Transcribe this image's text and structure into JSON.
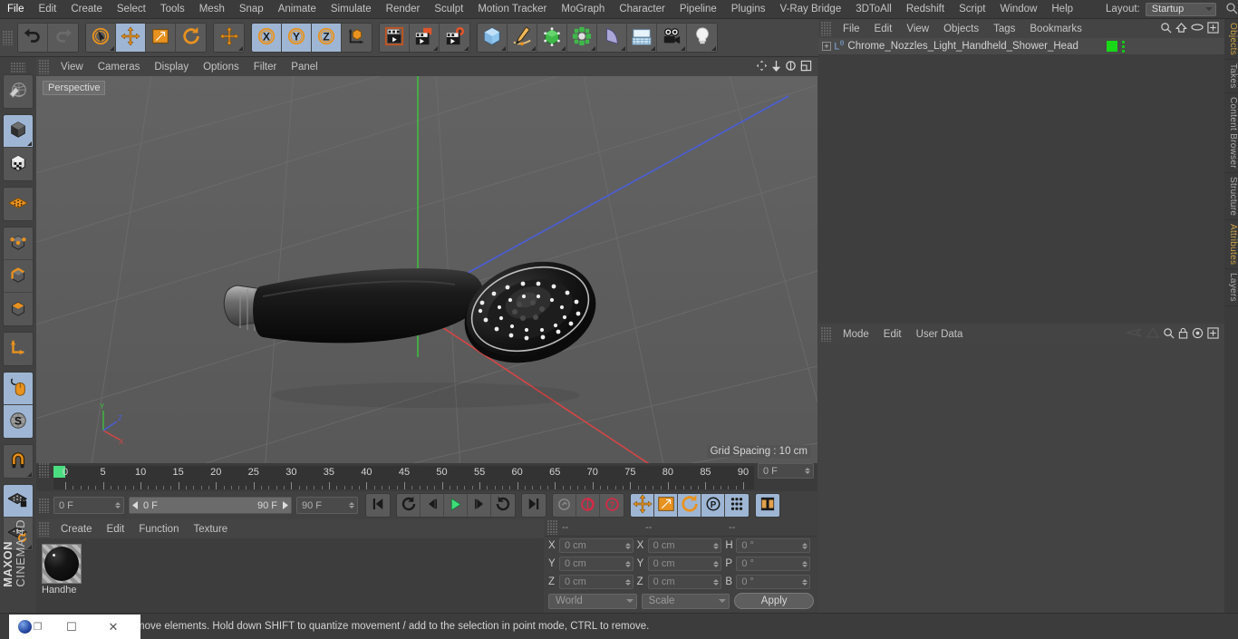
{
  "menubar": {
    "items": [
      "File",
      "Edit",
      "Create",
      "Select",
      "Tools",
      "Mesh",
      "Snap",
      "Animate",
      "Simulate",
      "Render",
      "Sculpt",
      "Motion Tracker",
      "MoGraph",
      "Character",
      "Pipeline",
      "Plugins",
      "V-Ray Bridge",
      "3DToAll",
      "Redshift",
      "Script",
      "Window",
      "Help"
    ],
    "layout_label": "Layout:",
    "layout_value": "Startup",
    "search_icon": "search-icon"
  },
  "toolbar": {
    "groups": [
      {
        "name": "undo-redo",
        "buttons": [
          {
            "name": "undo-button",
            "icon": "undo-icon",
            "active": false
          },
          {
            "name": "redo-button",
            "icon": "redo-icon",
            "active": false
          }
        ]
      },
      {
        "name": "transform-tools",
        "buttons": [
          {
            "name": "select-tool",
            "icon": "live-selection-icon",
            "active": false
          },
          {
            "name": "move-tool",
            "icon": "move-icon",
            "active": true
          },
          {
            "name": "scale-tool",
            "icon": "scale-icon",
            "active": false
          },
          {
            "name": "rotate-tool",
            "icon": "rotate-icon",
            "active": false
          }
        ]
      },
      {
        "name": "move-group",
        "buttons": [
          {
            "name": "move-tool-2",
            "icon": "move-icon",
            "active": false
          }
        ]
      },
      {
        "name": "axis-locks",
        "buttons": [
          {
            "name": "lock-x-button",
            "icon": "x-axis-icon",
            "active": true
          },
          {
            "name": "lock-y-button",
            "icon": "y-axis-icon",
            "active": true
          },
          {
            "name": "lock-z-button",
            "icon": "z-axis-icon",
            "active": true
          },
          {
            "name": "world-object-coord-button",
            "icon": "world-axis-icon",
            "active": false
          }
        ]
      },
      {
        "name": "render-tools",
        "buttons": [
          {
            "name": "render-view-button",
            "icon": "render-view-icon",
            "active": false
          },
          {
            "name": "render-region-button",
            "icon": "render-region-icon",
            "active": false
          },
          {
            "name": "render-settings-button",
            "icon": "render-settings-icon",
            "active": false
          }
        ]
      },
      {
        "name": "create-objects",
        "buttons": [
          {
            "name": "add-cube-button",
            "icon": "cube-icon",
            "active": false
          },
          {
            "name": "add-spline-button",
            "icon": "pen-spline-icon",
            "active": false
          },
          {
            "name": "add-generator-button",
            "icon": "green-cube-icon",
            "active": false
          },
          {
            "name": "add-deformer-button",
            "icon": "mograph-icon",
            "active": false
          },
          {
            "name": "add-bend-button",
            "icon": "bend-deformer-icon",
            "active": false
          },
          {
            "name": "add-environment-button",
            "icon": "floor-environment-icon",
            "active": false
          },
          {
            "name": "add-camera-button",
            "icon": "camera-icon",
            "active": false
          },
          {
            "name": "add-light-button",
            "icon": "light-bulb-icon",
            "active": false
          }
        ]
      }
    ]
  },
  "lefttools": {
    "groups": [
      {
        "buttons": [
          {
            "name": "make-editable-button",
            "icon": "make-editable-icon",
            "active": false
          }
        ]
      },
      {
        "buttons": [
          {
            "name": "model-mode-button",
            "icon": "model-mode-icon",
            "active": true
          },
          {
            "name": "texture-mode-button",
            "icon": "texture-mode-icon",
            "active": false
          }
        ]
      },
      {
        "buttons": [
          {
            "name": "points-deform-button",
            "icon": "mesh-grid-icon",
            "active": false
          }
        ]
      },
      {
        "buttons": [
          {
            "name": "points-mode-button",
            "icon": "points-mode-icon",
            "active": false
          },
          {
            "name": "edges-mode-button",
            "icon": "edges-mode-icon",
            "active": false
          },
          {
            "name": "polygons-mode-button",
            "icon": "polygons-mode-icon",
            "active": false
          }
        ]
      },
      {
        "buttons": [
          {
            "name": "object-axis-button",
            "icon": "axis-icon",
            "active": false
          }
        ]
      },
      {
        "buttons": [
          {
            "name": "viewport-solo-button",
            "icon": "mouse-icon",
            "active": true
          },
          {
            "name": "enable-snap-button",
            "icon": "snap-s-icon",
            "active": true
          }
        ]
      },
      {
        "buttons": [
          {
            "name": "magnet-button",
            "icon": "magnet-icon",
            "active": false
          }
        ]
      },
      {
        "buttons": [
          {
            "name": "workplane-lock-button",
            "icon": "workplane-lock-icon",
            "active": true
          },
          {
            "name": "workplane-rotate-button",
            "icon": "workplane-rotate-icon",
            "active": false
          }
        ]
      }
    ],
    "brand_top": "MAXON",
    "brand_bottom": "CINEMA 4D"
  },
  "viewport": {
    "menu": [
      "View",
      "Cameras",
      "Display",
      "Options",
      "Filter",
      "Panel"
    ],
    "icons": [
      "pan-icon",
      "zoom-icon",
      "rotate-view-icon",
      "maximize-view-icon"
    ],
    "perspective_label": "Perspective",
    "grid_spacing": "Grid Spacing : 10 cm",
    "axis_labels": {
      "x": "X",
      "y": "Y",
      "z": "Z"
    }
  },
  "timeline": {
    "ticks": [
      0,
      5,
      10,
      15,
      20,
      25,
      30,
      35,
      40,
      45,
      50,
      55,
      60,
      65,
      70,
      75,
      80,
      85,
      90
    ],
    "current_frame_field": "0 F",
    "playhead_frame": 0
  },
  "transport": {
    "current_frame": "0 F",
    "range_start": "0 F",
    "range_end": "90 F",
    "end_frame": "90 F",
    "buttons": [
      {
        "name": "go-to-start-button",
        "icon": "skip-start-icon",
        "active": false
      },
      {
        "name": "play-backwards-button",
        "icon": "play-back-icon",
        "active": false
      },
      {
        "name": "previous-frame-button",
        "icon": "step-back-icon",
        "active": false
      },
      {
        "name": "play-button",
        "icon": "play-icon",
        "active": false
      },
      {
        "name": "next-frame-button",
        "icon": "step-forward-icon",
        "active": false
      },
      {
        "name": "play-forward-loop-button",
        "icon": "loop-icon",
        "active": false
      },
      {
        "name": "go-to-end-button",
        "icon": "skip-end-icon",
        "active": false
      },
      {
        "name": "record-active-objects-button",
        "icon": "key-icon",
        "active": false
      },
      {
        "name": "autokeying-button",
        "icon": "autokey-icon",
        "active": false
      },
      {
        "name": "keyframe-selection-button",
        "icon": "question-icon",
        "active": false
      },
      {
        "name": "record-position-button",
        "icon": "move-icon",
        "active": true
      },
      {
        "name": "record-scale-button",
        "icon": "scale-icon",
        "active": true
      },
      {
        "name": "record-rotation-button",
        "icon": "rotate-icon",
        "active": true
      },
      {
        "name": "record-param-button",
        "icon": "p-param-icon",
        "active": true
      },
      {
        "name": "record-pla-button",
        "icon": "pla-dots-icon",
        "active": true
      },
      {
        "name": "timeline-toggle-button",
        "icon": "timeline-icon",
        "active": true
      }
    ]
  },
  "material_manager": {
    "menu": [
      "Create",
      "Edit",
      "Function",
      "Texture"
    ],
    "materials": [
      {
        "name": "Handhe",
        "icon": "material-sphere-icon"
      }
    ]
  },
  "coordinates": {
    "headers": [
      "--",
      "--",
      "--"
    ],
    "rows": [
      {
        "label1": "X",
        "value1": "0 cm",
        "label2": "X",
        "value2": "0 cm",
        "label3": "H",
        "value3": "0 °"
      },
      {
        "label1": "Y",
        "value1": "0 cm",
        "label2": "Y",
        "value2": "0 cm",
        "label3": "P",
        "value3": "0 °"
      },
      {
        "label1": "Z",
        "value1": "0 cm",
        "label2": "Z",
        "value2": "0 cm",
        "label3": "B",
        "value3": "0 °"
      }
    ],
    "system": "World",
    "mode": "Scale",
    "apply_label": "Apply"
  },
  "object_manager": {
    "menu": [
      "File",
      "Edit",
      "View",
      "Objects",
      "Tags",
      "Bookmarks"
    ],
    "icons": [
      "search-icon",
      "home-icon",
      "ellipse-icon",
      "plus-box-icon"
    ],
    "objects": [
      {
        "name": "Chrome_Nozzles_Light_Handheld_Shower_Head",
        "icon": "null-object-icon",
        "expandable": true
      }
    ]
  },
  "attribute_manager": {
    "menu": [
      "Mode",
      "Edit",
      "User Data"
    ],
    "icons": [
      "navigate-back-icon",
      "navigate-up-icon",
      "search-icon",
      "lock-icon",
      "target-icon",
      "plus-box-icon"
    ]
  },
  "right_tabs": [
    {
      "label": "Objects",
      "accent": true
    },
    {
      "label": "Takes",
      "accent": false
    },
    {
      "label": "Content Browser",
      "accent": false
    },
    {
      "label": "Structure",
      "accent": false
    },
    {
      "label": "Attributes",
      "accent": true
    },
    {
      "label": "Layers",
      "accent": false
    }
  ],
  "status": {
    "text": "move elements. Hold down SHIFT to quantize movement / add to the selection in point mode, CTRL to remove."
  },
  "taskbar": {
    "items": [
      "c4d-logo-icon",
      "restore-icon",
      "maximize-icon",
      "close-icon"
    ]
  },
  "colors": {
    "accent_orange": "#e8921f",
    "active_blue": "#9eb6d4",
    "green_tag": "#18d818",
    "panel_bg": "#414141"
  }
}
